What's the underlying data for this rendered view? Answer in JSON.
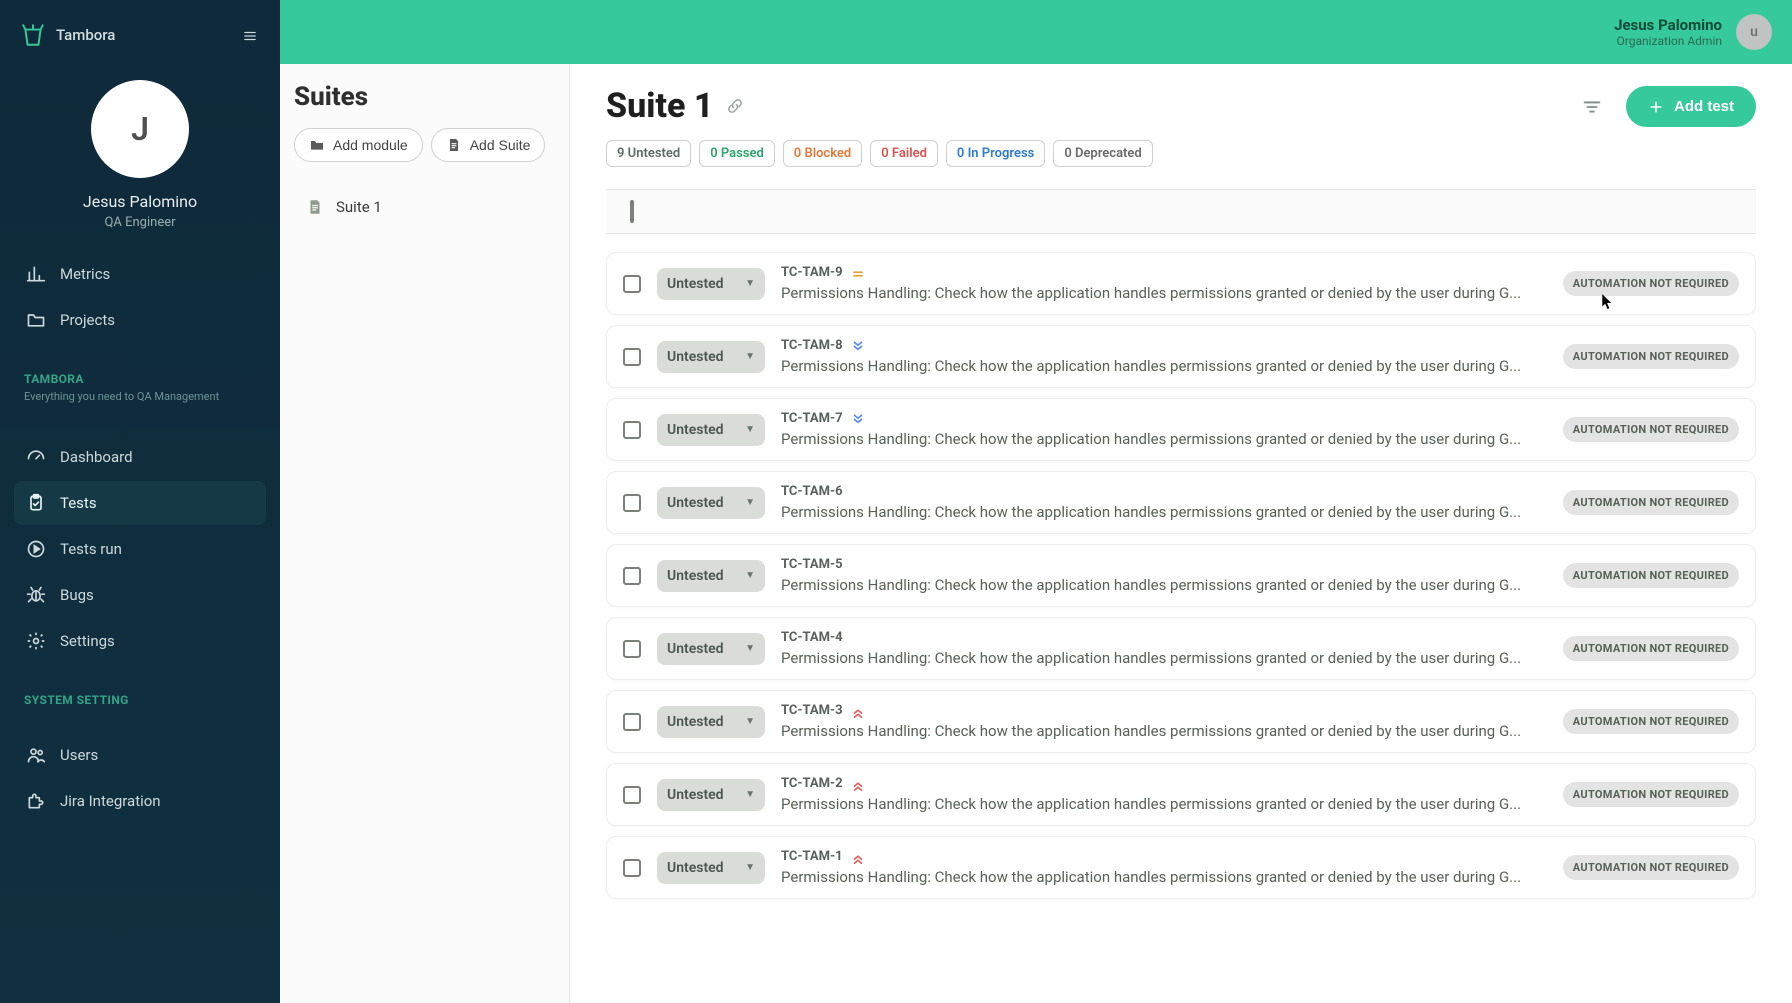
{
  "brand_name": "Tambora",
  "sidebar": {
    "profile_initial": "J",
    "profile_name": "Jesus Palomino",
    "profile_role": "QA Engineer",
    "items_top": [
      {
        "id": "metrics",
        "label": "Metrics",
        "icon": "chart-icon"
      },
      {
        "id": "projects",
        "label": "Projects",
        "icon": "folder-icon"
      }
    ],
    "section1_label": "TAMBORA",
    "section1_desc": "Everything you need to QA Management",
    "items_section1": [
      {
        "id": "dashboard",
        "label": "Dashboard",
        "icon": "speedometer-icon",
        "active": false
      },
      {
        "id": "tests",
        "label": "Tests",
        "icon": "clipboard-check-icon",
        "active": true
      },
      {
        "id": "testsrun",
        "label": "Tests run",
        "icon": "play-circle-icon",
        "active": false
      },
      {
        "id": "bugs",
        "label": "Bugs",
        "icon": "bug-icon",
        "active": false
      },
      {
        "id": "settings",
        "label": "Settings",
        "icon": "gear-icon",
        "active": false
      }
    ],
    "section2_label": "SYSTEM SETTING",
    "items_section2": [
      {
        "id": "users",
        "label": "Users",
        "icon": "users-icon"
      },
      {
        "id": "jira",
        "label": "Jira Integration",
        "icon": "puzzle-icon"
      }
    ]
  },
  "header": {
    "user_name": "Jesus Palomino",
    "user_role": "Organization Admin",
    "avatar_initial": "u"
  },
  "suites": {
    "title": "Suites",
    "add_module": "Add module",
    "add_suite": "Add Suite",
    "items": [
      {
        "label": "Suite 1"
      }
    ]
  },
  "main": {
    "title": "Suite 1",
    "add_test": "Add test",
    "counts": {
      "untested": "9 Untested",
      "passed": "0 Passed",
      "blocked": "0 Blocked",
      "failed": "0 Failed",
      "progress": "0 In Progress",
      "deprecated": "0 Deprecated"
    },
    "automation_label": "AUTOMATION NOT REQUIRED",
    "status_label": "Untested",
    "tests": [
      {
        "id": "TC-TAM-9",
        "priority": "medium",
        "desc": "Permissions Handling: Check how the application handles permissions granted or denied by the user during G..."
      },
      {
        "id": "TC-TAM-8",
        "priority": "low",
        "desc": "Permissions Handling: Check how the application handles permissions granted or denied by the user during G..."
      },
      {
        "id": "TC-TAM-7",
        "priority": "low",
        "desc": "Permissions Handling: Check how the application handles permissions granted or denied by the user during G..."
      },
      {
        "id": "TC-TAM-6",
        "priority": "none",
        "desc": "Permissions Handling: Check how the application handles permissions granted or denied by the user during G..."
      },
      {
        "id": "TC-TAM-5",
        "priority": "none",
        "desc": "Permissions Handling: Check how the application handles permissions granted or denied by the user during G..."
      },
      {
        "id": "TC-TAM-4",
        "priority": "none",
        "desc": "Permissions Handling: Check how the application handles permissions granted or denied by the user during G..."
      },
      {
        "id": "TC-TAM-3",
        "priority": "high",
        "desc": "Permissions Handling: Check how the application handles permissions granted or denied by the user during G..."
      },
      {
        "id": "TC-TAM-2",
        "priority": "high",
        "desc": "Permissions Handling: Check how the application handles permissions granted or denied by the user during G..."
      },
      {
        "id": "TC-TAM-1",
        "priority": "high",
        "desc": "Permissions Handling: Check how the application handles permissions granted or denied by the user during G..."
      }
    ]
  }
}
